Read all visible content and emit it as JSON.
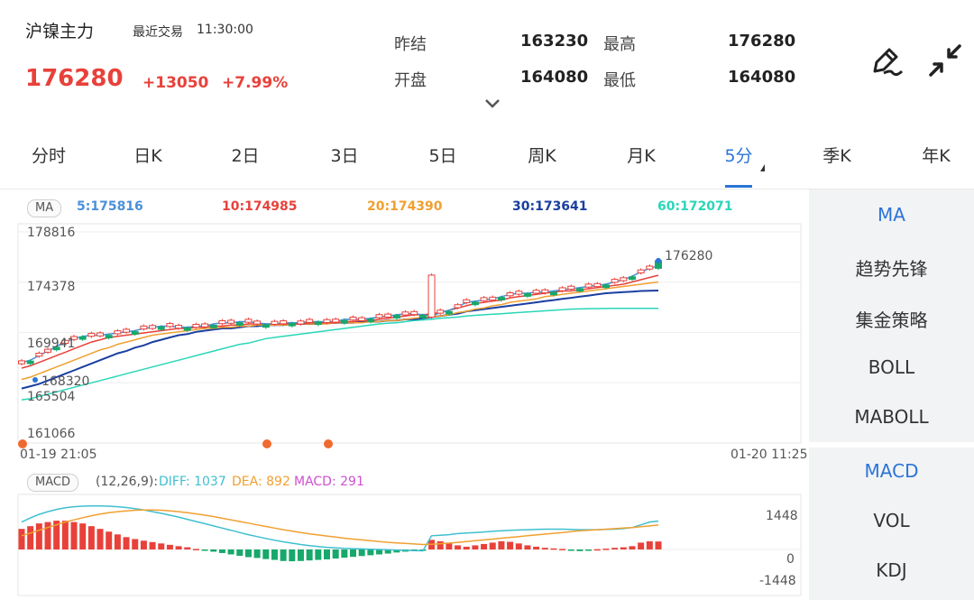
{
  "header": {
    "instrument": "沪镍主力",
    "last_trade_label": "最近交易",
    "last_trade_time": "11:30:00",
    "price": "176280",
    "change": "+13050",
    "change_pct": "+7.99%",
    "quotes": [
      {
        "label": "昨结",
        "value": "163230"
      },
      {
        "label": "最高",
        "value": "176280"
      },
      {
        "label": "开盘",
        "value": "164080"
      },
      {
        "label": "最低",
        "value": "164080"
      }
    ]
  },
  "tabs": [
    {
      "label": "分时",
      "active": false
    },
    {
      "label": "日K",
      "active": false
    },
    {
      "label": "2日",
      "active": false
    },
    {
      "label": "3日",
      "active": false
    },
    {
      "label": "5日",
      "active": false
    },
    {
      "label": "周K",
      "active": false
    },
    {
      "label": "月K",
      "active": false
    },
    {
      "label": "5分",
      "active": true
    },
    {
      "label": "季K",
      "active": false
    },
    {
      "label": "年K",
      "active": false
    }
  ],
  "indicator_panel_main": [
    "MA",
    "趋势先锋",
    "集金策略",
    "BOLL",
    "MABOLL"
  ],
  "indicator_panel_sub": [
    "MACD",
    "VOL",
    "KDJ"
  ],
  "colors": {
    "up": "#e8413a",
    "down": "#17a86b",
    "accent": "#2b74d9",
    "ma5": "#4a90d9",
    "ma10": "#e8413a",
    "ma20": "#f0a030",
    "ma30": "#1a3fa0",
    "ma60": "#2ad6b8",
    "diff": "#3fbfd0",
    "dea": "#f0a030",
    "macd": "#d050d0"
  },
  "main_chart": {
    "badge": "MA",
    "ma_values": [
      "5:175816",
      "10:174985",
      "20:174390",
      "30:173641",
      "60:172071"
    ],
    "y_ticks": [
      "178816",
      "174378",
      "169941",
      "165504",
      "161066"
    ],
    "last_price_label": "176280",
    "low_marker_label": "168320",
    "x_start": "01-19 21:05",
    "x_end": "01-20 11:25"
  },
  "sub_chart": {
    "badge": "MACD",
    "params": "(12,26,9):",
    "diff": "DIFF: 1037",
    "dea": "DEA: 892",
    "macd": "MACD: 291",
    "y_ticks": [
      "1448",
      "0",
      "-1448"
    ]
  },
  "chart_data": [
    {
      "type": "line",
      "title": "",
      "xlabel": "",
      "ylabel": "",
      "x_range": [
        "01-19 21:05",
        "01-20 11:25"
      ],
      "ylim": [
        161066,
        178816
      ],
      "y_ticks": [
        178816,
        174378,
        169941,
        165504,
        161066
      ],
      "grid": true,
      "last_price": 176280,
      "series": [
        {
          "name": "MA5",
          "last": 175816,
          "values": [
            167300,
            167500,
            167900,
            168300,
            168700,
            169100,
            169400,
            169600,
            169700,
            169700,
            169800,
            169900,
            170000,
            170100,
            170300,
            170400,
            170500,
            170500,
            170400,
            170400,
            170500,
            170500,
            170700,
            170800,
            170800,
            170900,
            170900,
            170800,
            170700,
            170700,
            170800,
            170800,
            170800,
            170900,
            170900,
            170900,
            170900,
            171100,
            171100,
            171100,
            171200,
            171300,
            171400,
            171500,
            171600,
            171600,
            171500,
            171400,
            171700,
            171900,
            172200,
            172600,
            172700,
            172800,
            172900,
            173100,
            173300,
            173400,
            173400,
            173500,
            173500,
            173600,
            173700,
            173800,
            173900,
            174000,
            174100,
            174200,
            174400,
            174600,
            174900,
            175300,
            175600,
            175816
          ]
        },
        {
          "name": "MA10",
          "last": 174985,
          "values": [
            166800,
            167000,
            167300,
            167600,
            167900,
            168200,
            168500,
            168800,
            169100,
            169300,
            169500,
            169600,
            169700,
            169800,
            169900,
            170000,
            170100,
            170200,
            170300,
            170300,
            170400,
            170400,
            170500,
            170500,
            170600,
            170600,
            170700,
            170700,
            170700,
            170700,
            170700,
            170700,
            170700,
            170800,
            170800,
            170800,
            170800,
            170900,
            170900,
            171000,
            171000,
            171100,
            171200,
            171300,
            171400,
            171500,
            171500,
            171600,
            171700,
            171900,
            172100,
            172300,
            172500,
            172600,
            172700,
            172800,
            173000,
            173100,
            173200,
            173300,
            173400,
            173500,
            173600,
            173600,
            173700,
            173800,
            173900,
            174000,
            174100,
            174200,
            174400,
            174600,
            174800,
            174985
          ]
        },
        {
          "name": "MA20",
          "last": 174390,
          "values": [
            165800,
            166000,
            166300,
            166600,
            166900,
            167200,
            167500,
            167800,
            168100,
            168400,
            168600,
            168900,
            169100,
            169300,
            169500,
            169700,
            169800,
            169900,
            170000,
            170100,
            170200,
            170300,
            170300,
            170400,
            170400,
            170500,
            170500,
            170600,
            170600,
            170600,
            170600,
            170700,
            170700,
            170700,
            170700,
            170700,
            170800,
            170800,
            170800,
            170800,
            170900,
            170900,
            171000,
            171000,
            171100,
            171200,
            171300,
            171300,
            171400,
            171500,
            171700,
            171800,
            172000,
            172100,
            172300,
            172400,
            172600,
            172700,
            172800,
            172900,
            173100,
            173200,
            173300,
            173400,
            173500,
            173600,
            173700,
            173800,
            173900,
            174000,
            174100,
            174200,
            174300,
            174390
          ]
        },
        {
          "name": "MA30",
          "last": 173641,
          "values": [
            165000,
            165200,
            165400,
            165700,
            166000,
            166300,
            166600,
            166900,
            167200,
            167500,
            167800,
            168100,
            168300,
            168600,
            168800,
            169100,
            169300,
            169500,
            169700,
            169800,
            170000,
            170100,
            170200,
            170300,
            170300,
            170400,
            170500,
            170500,
            170600,
            170600,
            170600,
            170700,
            170700,
            170700,
            170700,
            170800,
            170800,
            170800,
            170800,
            170900,
            170900,
            170900,
            171000,
            171000,
            171100,
            171100,
            171200,
            171300,
            171400,
            171500,
            171600,
            171800,
            171900,
            172000,
            172100,
            172200,
            172300,
            172400,
            172500,
            172600,
            172700,
            172800,
            172900,
            173000,
            173100,
            173200,
            173300,
            173400,
            173450,
            173500,
            173550,
            173600,
            173620,
            173641
          ]
        },
        {
          "name": "MA60",
          "last": 172071,
          "values": [
            164000,
            164100,
            164300,
            164500,
            164700,
            164900,
            165100,
            165300,
            165500,
            165700,
            165900,
            166100,
            166300,
            166500,
            166700,
            166900,
            167100,
            167300,
            167500,
            167700,
            167900,
            168100,
            168300,
            168500,
            168700,
            168900,
            169000,
            169200,
            169400,
            169500,
            169600,
            169700,
            169800,
            169900,
            170000,
            170100,
            170200,
            170300,
            170400,
            170500,
            170600,
            170700,
            170750,
            170800,
            170900,
            171000,
            171050,
            171100,
            171200,
            171250,
            171300,
            171400,
            171450,
            171500,
            171550,
            171600,
            171650,
            171700,
            171750,
            171800,
            171850,
            171900,
            171950,
            172000,
            172020,
            172040,
            172050,
            172060,
            172065,
            172068,
            172069,
            172070,
            172070,
            172071
          ]
        }
      ]
    },
    {
      "type": "bar",
      "title": "",
      "xlabel": "",
      "ylabel": "",
      "ylim": [
        -1448,
        1448
      ],
      "y_ticks": [
        1448,
        0,
        -1448
      ],
      "series": [
        {
          "name": "MACD",
          "values": [
            750,
            850,
            950,
            1000,
            1050,
            1050,
            1000,
            950,
            850,
            750,
            650,
            550,
            450,
            380,
            320,
            270,
            220,
            170,
            120,
            80,
            20,
            -30,
            -80,
            -130,
            -180,
            -230,
            -280,
            -310,
            -350,
            -380,
            -420,
            -430,
            -420,
            -400,
            -380,
            -360,
            -330,
            -300,
            -270,
            -240,
            -210,
            -180,
            -150,
            -110,
            -80,
            -40,
            -20,
            350,
            300,
            250,
            150,
            100,
            150,
            200,
            250,
            300,
            280,
            220,
            150,
            100,
            60,
            40,
            20,
            -30,
            -60,
            -20,
            10,
            30,
            60,
            80,
            120,
            250,
            300,
            291
          ]
        },
        {
          "name": "DIFF",
          "values": [
            1000,
            1150,
            1280,
            1380,
            1460,
            1520,
            1560,
            1580,
            1590,
            1590,
            1580,
            1560,
            1530,
            1490,
            1440,
            1380,
            1320,
            1250,
            1180,
            1100,
            1020,
            940,
            860,
            780,
            700,
            620,
            540,
            470,
            400,
            340,
            280,
            230,
            180,
            140,
            110,
            80,
            60,
            40,
            30,
            20,
            10,
            0,
            -10,
            -20,
            -30,
            -40,
            -50,
            500,
            520,
            540,
            580,
            600,
            620,
            640,
            660,
            680,
            700,
            710,
            720,
            730,
            740,
            740,
            740,
            730,
            720,
            720,
            720,
            730,
            740,
            760,
            800,
            900,
            1000,
            1037
          ]
        },
        {
          "name": "DEA",
          "values": [
            500,
            600,
            700,
            800,
            900,
            1000,
            1080,
            1160,
            1230,
            1290,
            1340,
            1380,
            1410,
            1430,
            1440,
            1440,
            1430,
            1410,
            1380,
            1340,
            1300,
            1250,
            1200,
            1140,
            1080,
            1020,
            960,
            900,
            840,
            780,
            720,
            670,
            620,
            570,
            530,
            490,
            450,
            410,
            380,
            350,
            320,
            290,
            260,
            240,
            220,
            200,
            180,
            190,
            210,
            230,
            260,
            290,
            320,
            350,
            380,
            410,
            440,
            470,
            500,
            530,
            560,
            590,
            620,
            650,
            680,
            700,
            720,
            740,
            760,
            780,
            800,
            830,
            860,
            892
          ]
        }
      ]
    }
  ]
}
